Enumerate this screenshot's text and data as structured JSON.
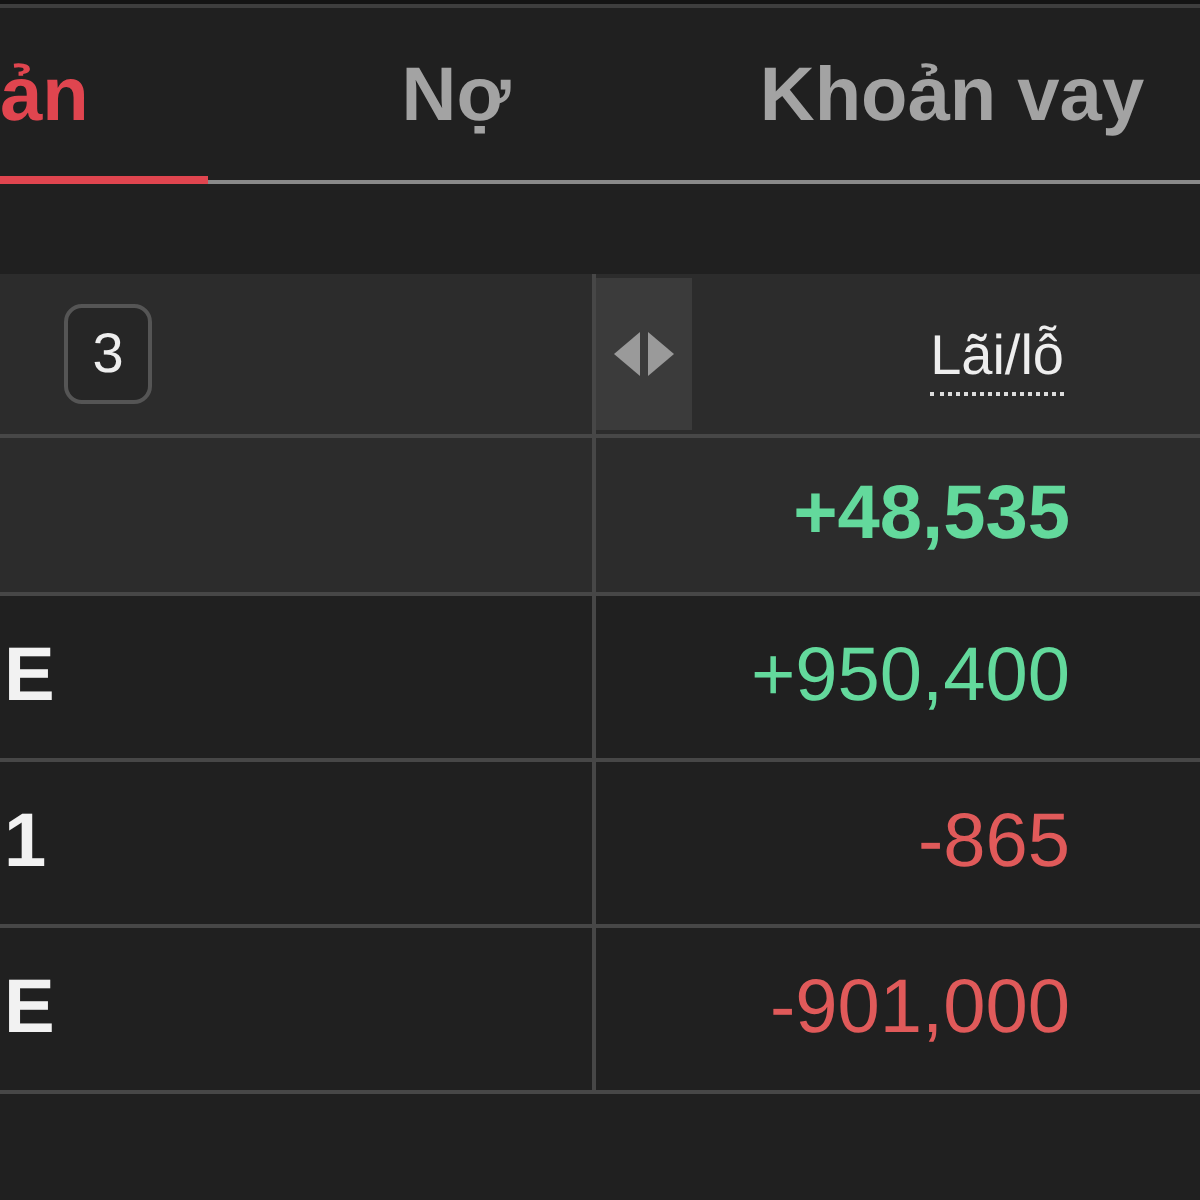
{
  "tabs": [
    {
      "label": "ản",
      "selected": true
    },
    {
      "label": "Nợ",
      "selected": false
    },
    {
      "label": "Khoản vay",
      "selected": false
    }
  ],
  "table": {
    "header": {
      "count_badge": "3",
      "value_column": "Lãi/lỗ"
    },
    "summary": {
      "value": "+48,535",
      "color": "#63d99c"
    },
    "rows": [
      {
        "column_1": "E",
        "value": "+950,400",
        "color": "#63d99c"
      },
      {
        "column_1": "1",
        "value": "-865",
        "color": "#e05a5a"
      },
      {
        "column_1": "E",
        "value": "-901,000",
        "color": "#e05a5a"
      }
    ]
  }
}
